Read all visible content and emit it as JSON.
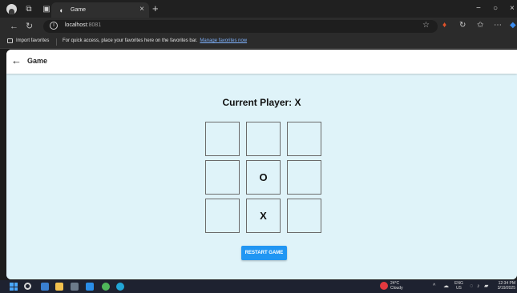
{
  "browser": {
    "tab_title": "Game",
    "tab_close": "×",
    "new_tab": "+",
    "window_minimize": "−",
    "window_maximize": "○",
    "window_close": "×",
    "url_host": "localhost",
    "url_port": ":8081"
  },
  "favorites_bar": {
    "import_label": "Import favorites",
    "message": "For quick access, place your favorites here on the favorites bar.",
    "manage_link": "Manage favorites now"
  },
  "app": {
    "back_icon": "←",
    "title": "Game",
    "current_player_label": "Current Player: X",
    "board": [
      "",
      "",
      "",
      "",
      "O",
      "",
      "",
      "X",
      ""
    ],
    "restart_label": "RESTART GAME",
    "accent_color": "#2196f3",
    "background_color": "#dff3f9"
  },
  "taskbar": {
    "weather_temp": "24°C",
    "weather_desc": "Cloudy",
    "lang_top": "ENG",
    "lang_bottom": "US",
    "time": "12:34 PM",
    "date": "3/19/2025"
  },
  "icons": [
    "profile-icon",
    "tabs-icon",
    "workspaces-icon",
    "back-nav-icon",
    "refresh-icon",
    "info-icon",
    "favorite-star-icon",
    "extension-icon",
    "copilot-icon",
    "more-icon",
    "windows-start-icon",
    "search-icon",
    "file-explorer-icon",
    "vscode-icon",
    "chrome-icon",
    "weather-icon"
  ]
}
